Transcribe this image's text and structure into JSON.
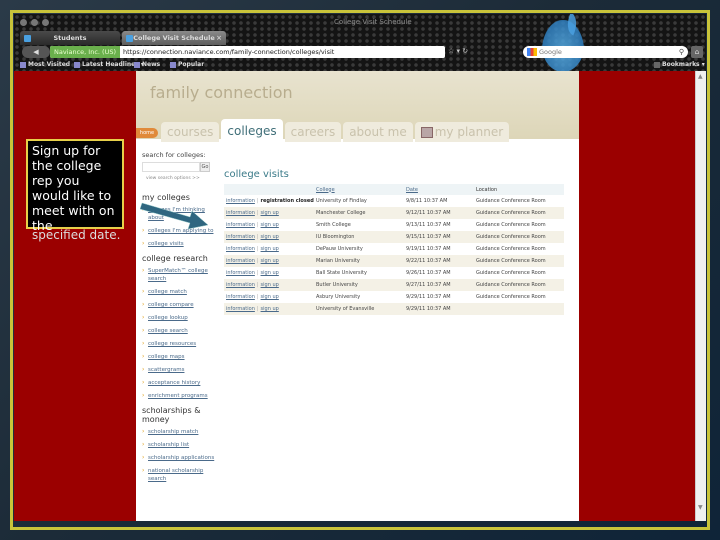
{
  "browser": {
    "window_title": "College Visit Schedule",
    "tabs": [
      {
        "label": "Students",
        "active": false
      },
      {
        "label": "College Visit Schedule",
        "active": true
      }
    ],
    "back_label": "◀",
    "identity_label": "Naviance, Inc. (US)",
    "url": "https://connection.naviance.com/family-connection/colleges/visit",
    "url_icons": "☆ ▾ ↻",
    "search_placeholder": "Google",
    "home_icon": "⌂",
    "bookmarks_toolbar": [
      {
        "label": "Most Visited"
      },
      {
        "label": "Latest Headlines ▾"
      },
      {
        "label": "News"
      },
      {
        "label": "Popular"
      }
    ],
    "bookmarks_menu": "Bookmarks ▾"
  },
  "site": {
    "brand": "family connection",
    "home_pill": "home",
    "nav_tabs": [
      {
        "label": "courses",
        "active": false
      },
      {
        "label": "colleges",
        "active": true
      },
      {
        "label": "careers",
        "active": false
      },
      {
        "label": "about me",
        "active": false
      },
      {
        "label": "my planner",
        "active": false
      }
    ]
  },
  "sidebar": {
    "search_label": "search for colleges:",
    "search_value": "",
    "go_label": "Go",
    "more_search_options": "view search options >>",
    "sections": [
      {
        "heading": "my colleges",
        "items": [
          "colleges I'm thinking about",
          "colleges I'm applying to",
          "college visits"
        ]
      },
      {
        "heading": "college research",
        "items": [
          "SuperMatch™ college search",
          "college match",
          "college compare",
          "college lookup",
          "college search",
          "college resources",
          "college maps",
          "scattergrams",
          "acceptance history",
          "enrichment programs"
        ]
      },
      {
        "heading": "scholarships & money",
        "items": [
          "scholarship match",
          "scholarship list",
          "scholarship applications",
          "national scholarship search"
        ]
      }
    ]
  },
  "visits": {
    "title": "college visits",
    "columns": [
      "",
      "College",
      "Date",
      "Location"
    ],
    "info_label": "information",
    "signup_label": "sign up",
    "closed_label": "registration closed",
    "rows": [
      {
        "status": "closed",
        "college": "University of Findlay",
        "date": "9/8/11 10:37 AM",
        "location": "Guidance Conference Room"
      },
      {
        "status": "open",
        "college": "Manchester College",
        "date": "9/12/11 10:37 AM",
        "location": "Guidance Conference Room"
      },
      {
        "status": "open",
        "college": "Smith College",
        "date": "9/13/11 10:37 AM",
        "location": "Guidance Conference Room"
      },
      {
        "status": "open",
        "college": "IU Bloomington",
        "date": "9/15/11 10:37 AM",
        "location": "Guidance Conference Room"
      },
      {
        "status": "open",
        "college": "DePauw University",
        "date": "9/19/11 10:37 AM",
        "location": "Guidance Conference Room"
      },
      {
        "status": "open",
        "college": "Marian University",
        "date": "9/22/11 10:37 AM",
        "location": "Guidance Conference Room"
      },
      {
        "status": "open",
        "college": "Ball State University",
        "date": "9/26/11 10:37 AM",
        "location": "Guidance Conference Room"
      },
      {
        "status": "open",
        "college": "Butler University",
        "date": "9/27/11 10:37 AM",
        "location": "Guidance Conference Room"
      },
      {
        "status": "open",
        "college": "Asbury University",
        "date": "9/29/11 10:37 AM",
        "location": "Guidance Conference Room"
      },
      {
        "status": "open",
        "college": "University of Evansville",
        "date": "9/29/11 10:37 AM",
        "location": ""
      }
    ]
  },
  "callout": {
    "text": "Sign up for the college rep you would like to meet with on the",
    "overflow_text": "specified date."
  },
  "colors": {
    "background_red": "#9b0000",
    "frame_yellow": "#c9c43a",
    "link_blue": "#4a6a8a",
    "heading_teal": "#3a7a88"
  }
}
